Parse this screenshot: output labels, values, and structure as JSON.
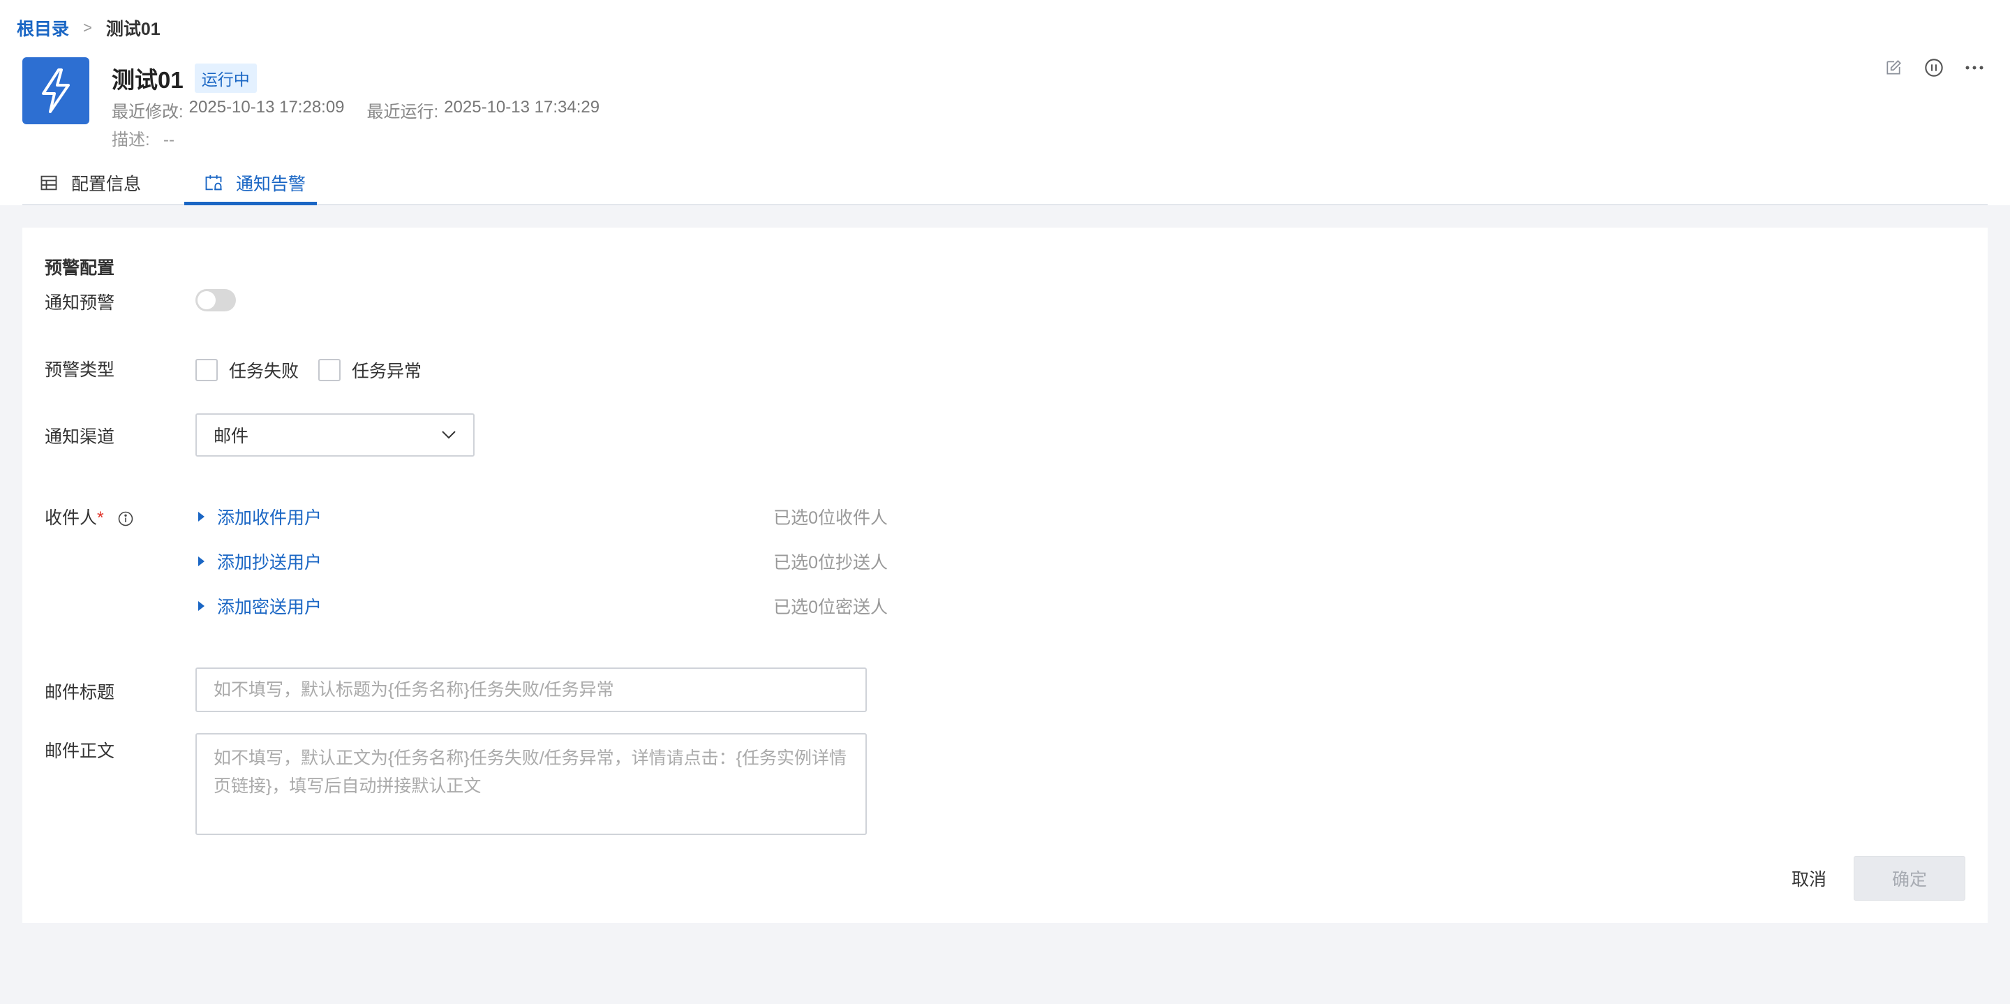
{
  "breadcrumb": {
    "root": "根目录",
    "separator": ">",
    "current": "测试01"
  },
  "header": {
    "title": "测试01",
    "status": "运行中",
    "modified_label": "最近修改:",
    "modified_value": "2025-10-13 17:28:09",
    "run_label": "最近运行:",
    "run_value": "2025-10-13 17:34:29",
    "desc_label": "描述:",
    "desc_value": "--",
    "icons": {
      "app": "lightning-icon",
      "edit": "edit-icon",
      "pause": "pause-icon",
      "more": "more-icon"
    }
  },
  "tabs": [
    {
      "label": "配置信息",
      "icon": "table-icon",
      "active": false
    },
    {
      "label": "通知告警",
      "icon": "calendar-bell-icon",
      "active": true
    }
  ],
  "form": {
    "section_title": "预警配置",
    "notify_label": "通知预警",
    "notify_enabled": false,
    "type_label": "预警类型",
    "type_options": [
      "任务失败",
      "任务异常"
    ],
    "channel_label": "通知渠道",
    "channel_value": "邮件",
    "recipients_label": "收件人",
    "required_mark": "*",
    "recipients": [
      {
        "action": "添加收件用户",
        "count": "已选0位收件人"
      },
      {
        "action": "添加抄送用户",
        "count": "已选0位抄送人"
      },
      {
        "action": "添加密送用户",
        "count": "已选0位密送人"
      }
    ],
    "subject_label": "邮件标题",
    "subject_placeholder": "如不填写，默认标题为{任务名称}任务失败/任务异常",
    "body_label": "邮件正文",
    "body_placeholder": "如不填写，默认正文为{任务名称}任务失败/任务异常，详情请点击：{任务实例详情页链接}，填写后自动拼接默认正文"
  },
  "actions": {
    "cancel": "取消",
    "confirm": "确定"
  },
  "colors": {
    "accent": "#1a66c4",
    "app_icon_bg": "#2d6fd2",
    "badge_bg": "#e4f1ff"
  }
}
